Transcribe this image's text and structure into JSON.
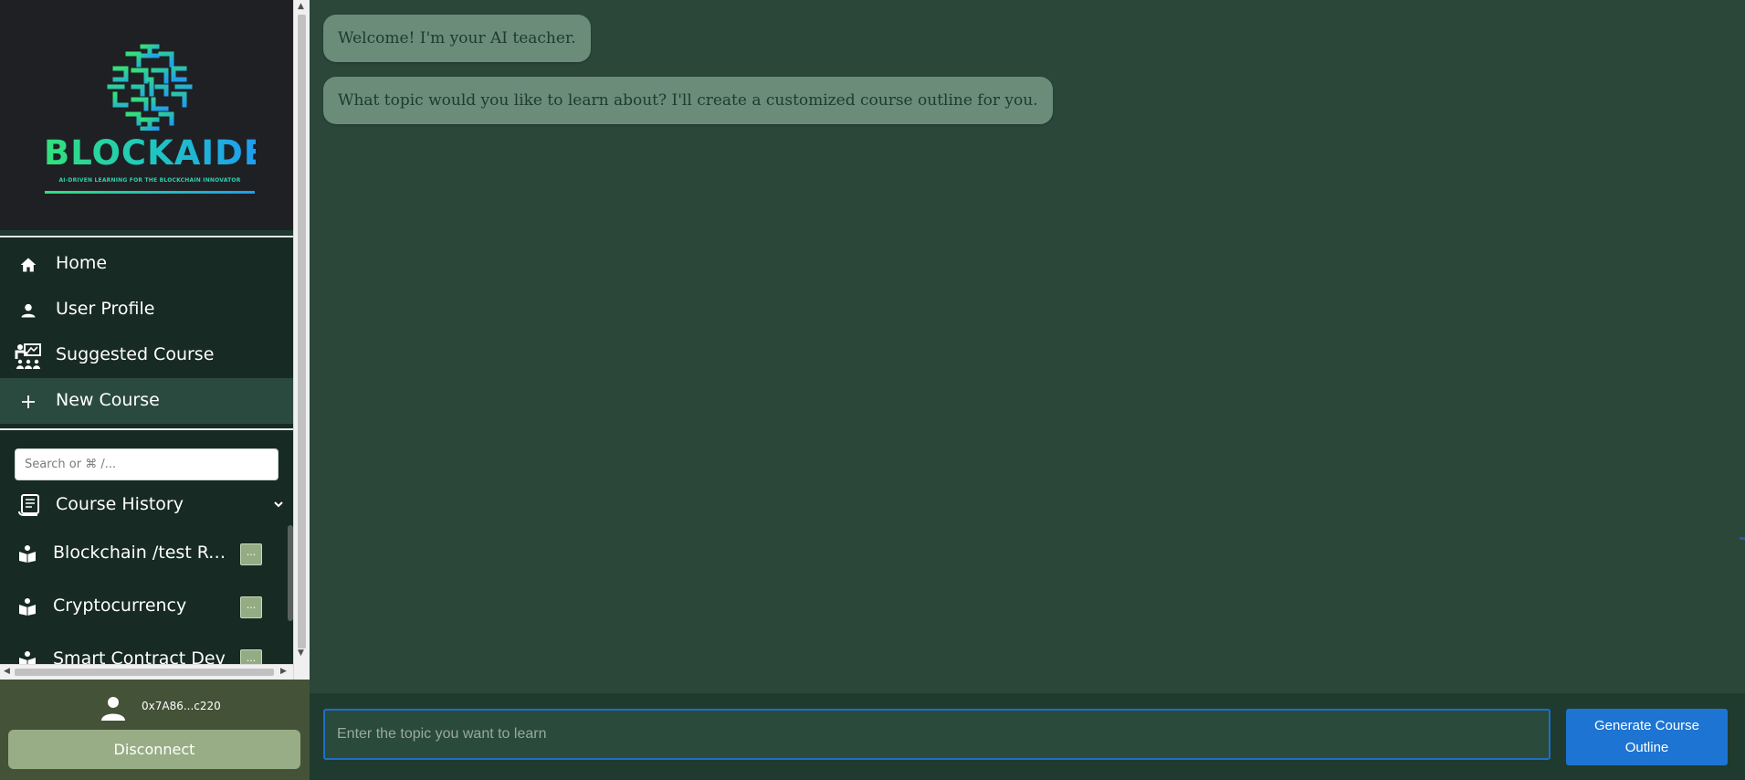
{
  "brand": {
    "name": "BLOCKAIDE",
    "tagline": "AI-DRIVEN LEARNING FOR THE BLOCKCHAIN INNOVATOR",
    "colors": {
      "gradient_start": "#33e07a",
      "gradient_end": "#1f9df0"
    }
  },
  "sidebar": {
    "nav": [
      {
        "label": "Home",
        "icon": "home-icon"
      },
      {
        "label": "User Profile",
        "icon": "user-icon"
      },
      {
        "label": "Suggested Course",
        "icon": "teacher-board-icon"
      },
      {
        "label": "New Course",
        "icon": "plus-icon",
        "active": true
      }
    ],
    "search": {
      "placeholder": "Search or ⌘ /..."
    },
    "history": {
      "title": "Course History",
      "items": [
        {
          "label": "Blockchain /test Re...",
          "more": "..."
        },
        {
          "label": "Cryptocurrency",
          "more": "..."
        },
        {
          "label": "Smart Contract Dev",
          "more": "..."
        }
      ]
    },
    "footer": {
      "address": "0x7A86...c220",
      "disconnect_label": "Disconnect"
    }
  },
  "chat": {
    "messages": [
      {
        "text": "Welcome! I'm your AI teacher."
      },
      {
        "text": "What topic would you like to learn about? I'll create a customized course outline for you."
      }
    ]
  },
  "composer": {
    "placeholder": "Enter the topic you want to learn",
    "button_line1": "Generate Course",
    "button_line2": "Outline"
  },
  "colors": {
    "main_bg": "#2a473a",
    "bubble_bg": "#6a8c78",
    "accent_button": "#1e74d2",
    "disconnect_bg": "#98ad86"
  }
}
